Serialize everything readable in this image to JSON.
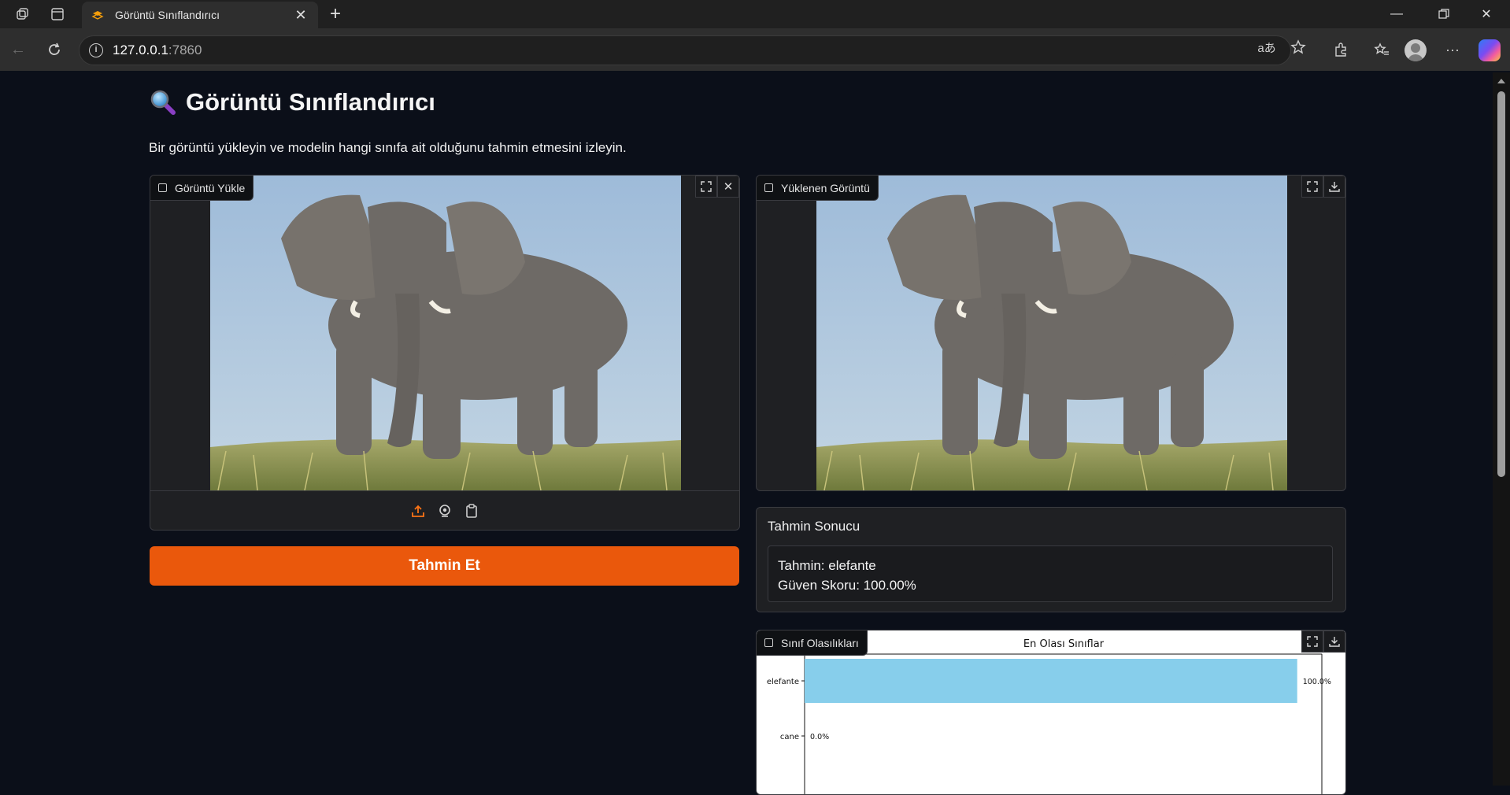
{
  "browser": {
    "tab_title": "Görüntü Sınıflandırıcı",
    "url_host": "127.0.0.1",
    "url_port": ":7860"
  },
  "page": {
    "title": "Görüntü Sınıflandırıcı",
    "description": "Bir görüntü yükleyin ve modelin hangi sınıfa ait olduğunu tahmin etmesini izleyin."
  },
  "upload_panel": {
    "label": "Görüntü Yükle"
  },
  "preview_panel": {
    "label": "Yüklenen Görüntü"
  },
  "predict_button": {
    "label": "Tahmin Et"
  },
  "result": {
    "title": "Tahmin Sonucu",
    "prediction_line": "Tahmin: elefante",
    "confidence_line": "Güven Skoru: 100.00%"
  },
  "prob_panel": {
    "label": "Sınıf Olasılıkları"
  },
  "chart_data": {
    "type": "bar",
    "orientation": "horizontal",
    "title": "En Olası Sınıflar",
    "categories": [
      "elefante",
      "cane"
    ],
    "values": [
      100.0,
      0.0
    ],
    "value_labels": [
      "100.0%",
      "0.0%"
    ],
    "xlim": [
      0,
      105
    ],
    "bar_color": "#87ceeb"
  }
}
